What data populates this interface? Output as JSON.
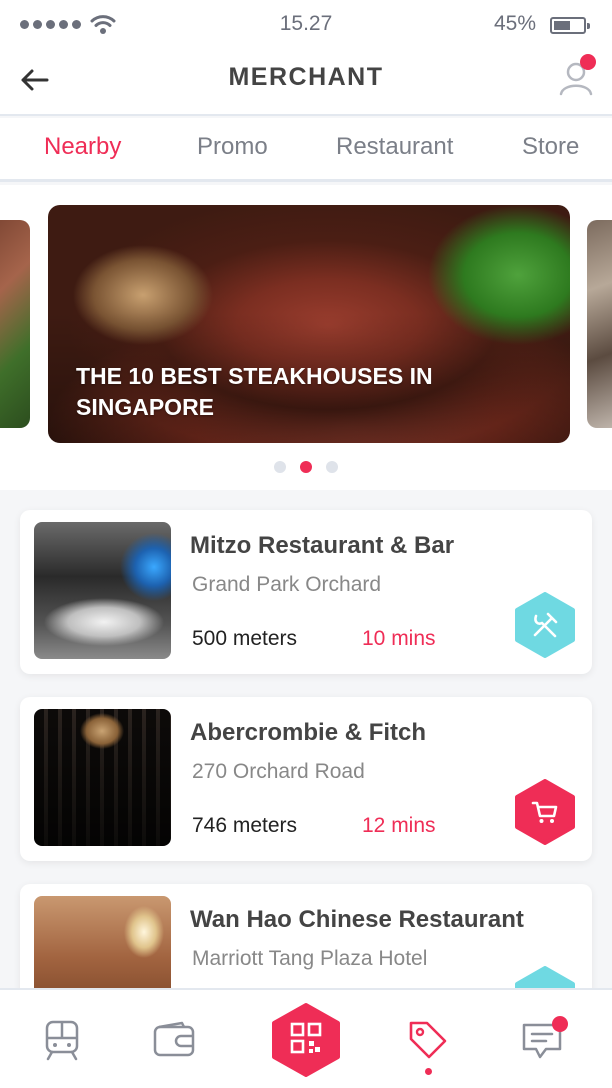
{
  "status_bar": {
    "time": "15.27",
    "battery": "45%"
  },
  "header": {
    "title": "MERCHANT"
  },
  "tabs": [
    {
      "label": "Nearby",
      "active": true
    },
    {
      "label": "Promo",
      "active": false
    },
    {
      "label": "Restaurant",
      "active": false
    },
    {
      "label": "Store",
      "active": false
    }
  ],
  "carousel": {
    "featured_title": "THE 10 BEST STEAKHOUSES IN SINGAPORE",
    "dot_count": 3,
    "active_dot": 2
  },
  "merchants": [
    {
      "name": "Mitzo Restaurant & Bar",
      "address": "Grand Park Orchard",
      "distance": "500 meters",
      "eta": "10 mins",
      "category_icon": "fork-knife-icon",
      "badge_color": "#6fd9e2"
    },
    {
      "name": "Abercrombie & Fitch",
      "address": "270 Orchard Road",
      "distance": "746 meters",
      "eta": "12 mins",
      "category_icon": "cart-icon",
      "badge_color": "#ef2d56"
    },
    {
      "name": "Wan Hao Chinese Restaurant",
      "address": "Marriott Tang Plaza Hotel",
      "distance": "",
      "eta": "",
      "category_icon": "fork-knife-icon",
      "badge_color": "#6fd9e2"
    }
  ],
  "bottom_nav": {
    "items": [
      {
        "icon": "train-icon",
        "active": false
      },
      {
        "icon": "wallet-icon",
        "active": false
      },
      {
        "icon": "qr-code-icon",
        "active": false
      },
      {
        "icon": "tag-icon",
        "active": true
      },
      {
        "icon": "chat-icon",
        "active": false
      }
    ]
  },
  "colors": {
    "accent": "#ef2d56",
    "teal": "#6fd9e2",
    "icon_gray": "#8a8e98"
  }
}
